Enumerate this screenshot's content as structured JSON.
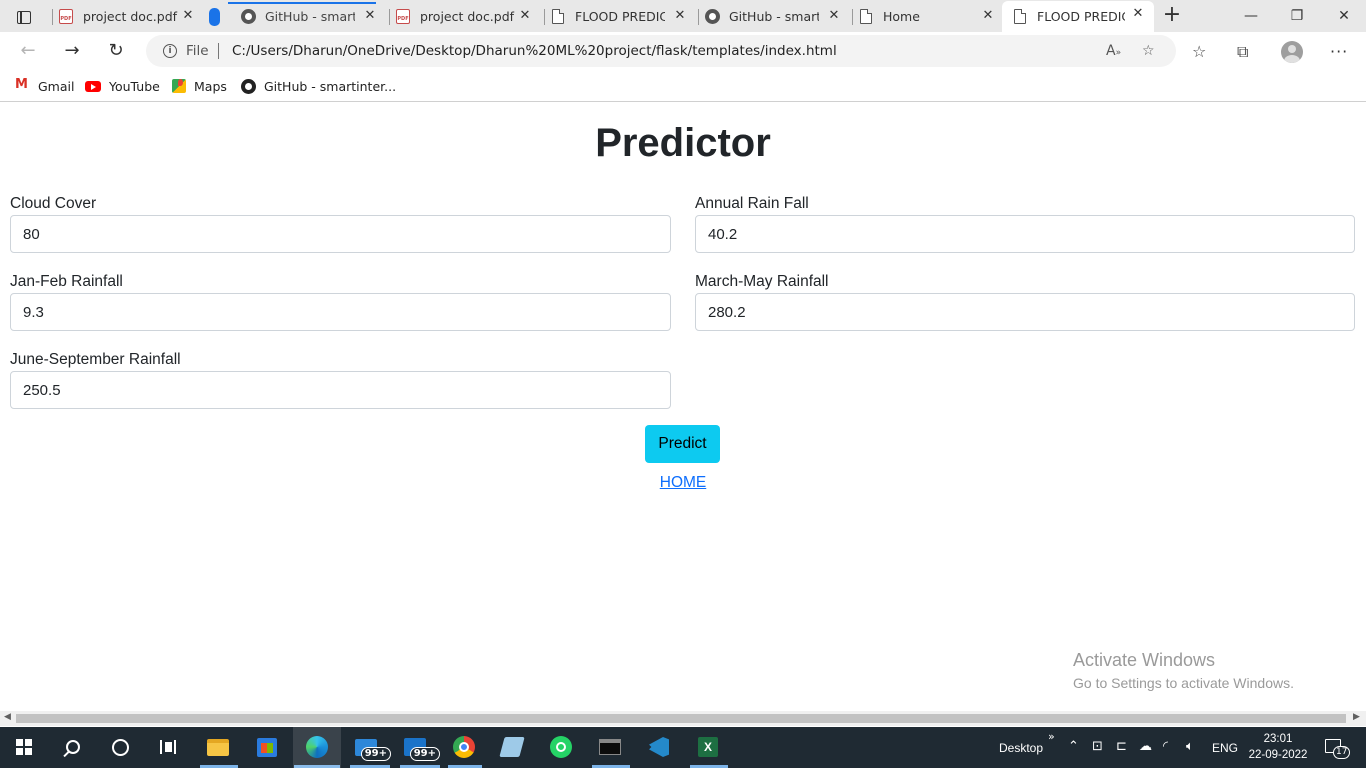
{
  "browser": {
    "tabs": [
      {
        "title": "project doc.pdf",
        "icon": "pdf-icon"
      },
      {
        "title": "GitHub - smartin",
        "icon": "github-icon"
      },
      {
        "title": "project doc.pdf",
        "icon": "pdf-icon"
      },
      {
        "title": "FLOOD PREDICT",
        "icon": "page-icon"
      },
      {
        "title": "GitHub - smartin",
        "icon": "github-icon"
      },
      {
        "title": "Home",
        "icon": "page-icon"
      },
      {
        "title": "FLOOD PREDICT",
        "icon": "page-icon",
        "active": true
      }
    ],
    "address_bar": {
      "scheme_label": "File",
      "url": "C:/Users/Dharun/OneDrive/Desktop/Dharun%20ML%20project/flask/templates/index.html"
    },
    "favorites": [
      {
        "label": "Gmail",
        "icon": "gmail-icon"
      },
      {
        "label": "YouTube",
        "icon": "youtube-icon"
      },
      {
        "label": "Maps",
        "icon": "maps-icon"
      },
      {
        "label": "GitHub - smartinter...",
        "icon": "github-icon"
      }
    ]
  },
  "page": {
    "title": "Predictor",
    "fields": {
      "cloud_cover": {
        "label": "Cloud Cover",
        "value": "80"
      },
      "annual_rain_fall": {
        "label": "Annual Rain Fall",
        "value": "40.2"
      },
      "jan_feb_rainfall": {
        "label": "Jan-Feb Rainfall",
        "value": "9.3"
      },
      "march_may_rainfall": {
        "label": "March-May Rainfall",
        "value": "280.2"
      },
      "june_september_rainfall": {
        "label": "June-September Rainfall",
        "value": "250.5"
      }
    },
    "predict_button": "Predict",
    "home_link": "HOME",
    "accent_color": "#0dcaf0",
    "link_color": "#0d6efd"
  },
  "watermark": {
    "line1": "Activate Windows",
    "line2": "Go to Settings to activate Windows."
  },
  "taskbar": {
    "desktop_label": "Desktop",
    "chevron": "»",
    "language": "ENG",
    "time": "23:01",
    "date": "22-09-2022",
    "mail_badge": "99+",
    "outlook_badge": "99+",
    "notification_count": "17"
  }
}
